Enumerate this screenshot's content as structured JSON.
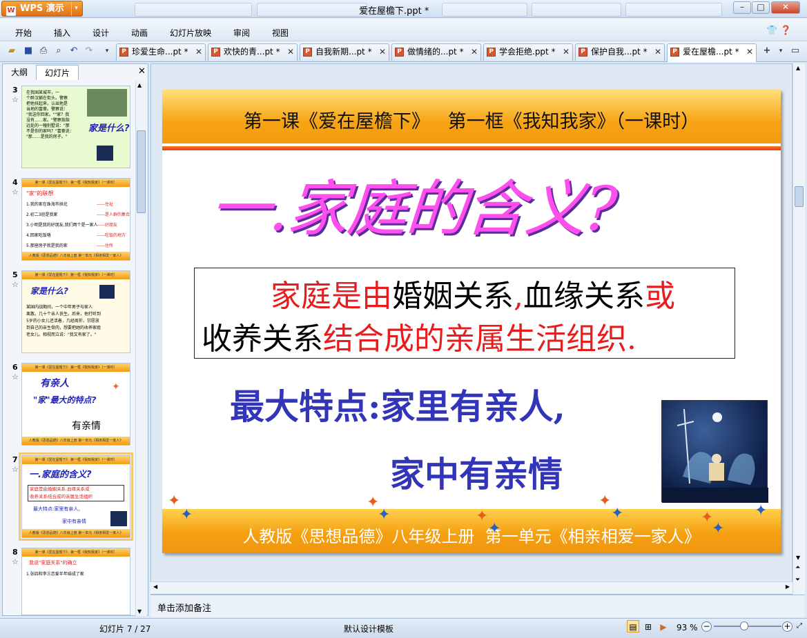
{
  "app": {
    "wps_button": "WPS 演示",
    "window_title": "爱在屋檐下.ppt *",
    "menu": [
      "开始",
      "插入",
      "设计",
      "动画",
      "幻灯片放映",
      "审阅",
      "视图"
    ],
    "tabs": [
      {
        "label": "珍爱生命...pt *"
      },
      {
        "label": "欢快的青...pt *"
      },
      {
        "label": "自我新期...pt *"
      },
      {
        "label": "做情绪的...pt *"
      },
      {
        "label": "学会拒绝.ppt *"
      },
      {
        "label": "保护自我...pt *"
      },
      {
        "label": "爱在屋檐...pt *",
        "active": true
      }
    ]
  },
  "panel": {
    "tab_outline": "大纲",
    "tab_slides": "幻灯片",
    "thumbs": [
      {
        "num": "3",
        "lines": [
          "在我国某城市，一",
          "个醉汉躺在街头。警察",
          "把他扶起来，认出他是",
          "当地的富豪。警察说：",
          "\"我送你回家。\"\"家？我",
          "没有……家。\"警察指指",
          "远处的一幢别墅说：\"那",
          "不是你的家吗？\"富豪说：",
          "\"那……是我的房子。\""
        ],
        "side": "家是什么?"
      },
      {
        "num": "4",
        "title": "\"家\"的联想",
        "lines": [
          "1.我的家在珠海市拱北",
          "2.初二3班是我家",
          "3.小明是我的好朋友,我们两个是一家人",
          "4.回家吃饭咯",
          "5.那座房子就是我的家"
        ],
        "answers": [
          "——住址",
          "——是人群的集合体",
          "——好朋友",
          "——吃饭的地方",
          "——住所"
        ]
      },
      {
        "num": "5",
        "title": "家是什么?",
        "lines": [
          "某国内战期间，一个中年男子与家人",
          "离散。几十个亲人丧生。后来，他打听到",
          "5岁的小女儿还活着，几经周折，甘愿放",
          "到自己的亲生骨肉，想要把她的收养家庭",
          "老女儿。相视而泣说：\"我又有家了。\""
        ]
      },
      {
        "num": "6",
        "lines": [
          "有亲人",
          "\"家\"最大的特点?",
          "有亲情"
        ]
      },
      {
        "num": "7",
        "title": "一.家庭的含义?",
        "lines": [
          "家庭是由婚姻关系,血缘关系或",
          "收养关系结合成的亲属生活组织",
          "最大特点:家里有亲人,",
          "家中有亲情"
        ]
      },
      {
        "num": "8",
        "title": "我说\"家庭关系\"的确立",
        "lines": [
          "1.张四和李三恋爱半年结成了家"
        ]
      }
    ],
    "thumb_header": "第一课《爱在屋檐下》   第一框《我知我家》（一课时）",
    "thumb_footer": "人教版《思想品德》八年级上册  第一单元《相亲相爱一家人》"
  },
  "slide": {
    "header": "第一课《爱在屋檐下》   第一框《我知我家》（一课时）",
    "title": "一.家庭的含义?",
    "definition": [
      [
        {
          "t": "家庭是由",
          "c": "red"
        },
        {
          "t": "婚姻关系",
          "c": "black"
        },
        {
          "t": ",",
          "c": "red"
        },
        {
          "t": "血缘关系",
          "c": "black"
        },
        {
          "t": "或",
          "c": "red"
        }
      ],
      [
        {
          "t": "收养关系",
          "c": "black"
        },
        {
          "t": "结合成的亲属生活组织",
          "c": "red"
        },
        {
          "t": ".",
          "c": "red"
        }
      ]
    ],
    "feature_line1": "最大特点:家里有亲人,",
    "feature_line2": "家中有亲情",
    "footer": "人教版《思想品德》八年级上册  第一单元《相亲相爱一家人》"
  },
  "notes_placeholder": "单击添加备注",
  "status": {
    "slide_counter": "幻灯片 7 / 27",
    "template": "默认设计模板",
    "zoom": "93 %",
    "zoom_percent": 93
  },
  "colors": {
    "accent_orange": "#f39a10",
    "title_magenta": "#ff4fef",
    "text_blue": "#3335b9",
    "text_red": "#e81c1c"
  }
}
